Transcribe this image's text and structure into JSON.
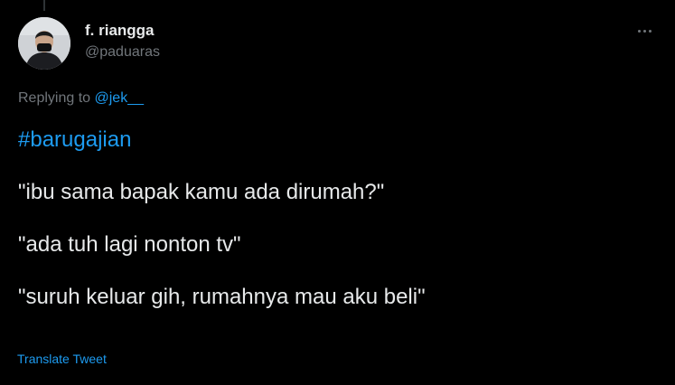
{
  "tweet": {
    "author": {
      "display_name": "f. riangga",
      "handle": "@paduaras",
      "avatar_icon": "user-avatar-photo"
    },
    "more_icon": "more-horizontal-icon",
    "replying_to": {
      "prefix": "Replying to ",
      "mention": "@jek__"
    },
    "body": {
      "hashtag": "#barugajian",
      "lines": [
        "\"ibu sama bapak kamu ada dirumah?\"",
        "\"ada tuh lagi nonton tv\"",
        "\"suruh keluar gih, rumahnya mau aku beli\""
      ]
    },
    "translate_label": "Translate Tweet"
  },
  "colors": {
    "background": "#000000",
    "text_primary": "#e7e9ea",
    "text_secondary": "#71767b",
    "accent": "#1d9bf0"
  }
}
